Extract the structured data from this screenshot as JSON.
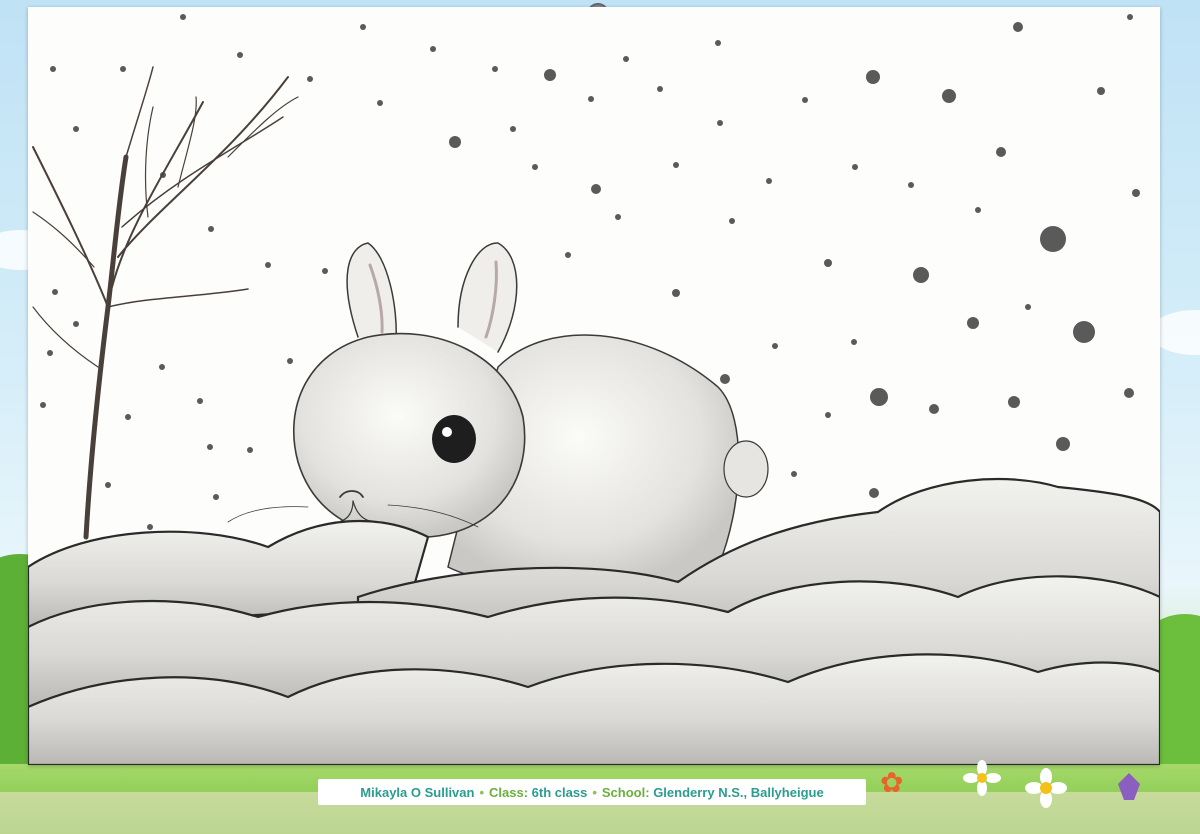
{
  "caption": {
    "name": "Mikayla O Sullivan",
    "class_label": "Class:",
    "class_value": "6th class",
    "school_label": "School:",
    "school_value": "Glenderry N.S., Ballyheigue",
    "separator": "•"
  },
  "artwork": {
    "subject_icons": [
      "bunny-drawing",
      "bare-tree-drawing",
      "snow-hills-drawing",
      "snowflake-dots"
    ]
  },
  "colors": {
    "caption_name": "#2a9d8f",
    "caption_label": "#6ab03d",
    "paper": "#fdfdfc",
    "pencil": "#3a3a3a"
  }
}
